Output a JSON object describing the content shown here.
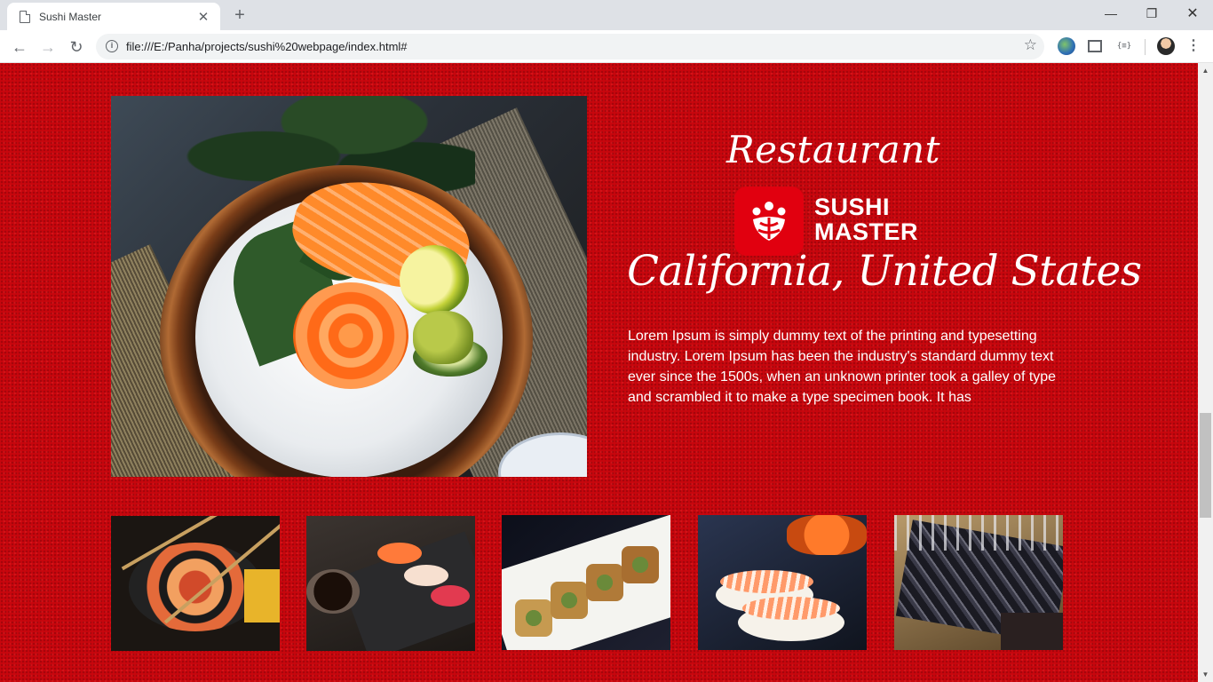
{
  "browser": {
    "tab_title": "Sushi Master",
    "tab_close": "✕",
    "new_tab": "+",
    "url": "file:///E:/Panha/projects/sushi%20webpage/index.html#",
    "controls": {
      "minimize": "—",
      "restore": "❐",
      "close": "✕"
    },
    "nav": {
      "back": "←",
      "forward": "→",
      "reload": "↻"
    },
    "star": "☆",
    "code_ext": "{≡}",
    "menu": "⋮"
  },
  "page": {
    "restaurant_heading": "Restaurant",
    "logo": {
      "line1": "SUSHI",
      "line2": "MASTER"
    },
    "location_heading": "California, United States",
    "description": "Lorem Ipsum is simply dummy text of the printing and typesetting industry. Lorem Ipsum has been the industry's standard dummy text ever since the 1500s, when an unknown printer took a galley of type and scrambled it to make a type specimen book. It has",
    "accent_color": "#c8060d",
    "thumbnails": [
      "sushi-platter-chopsticks",
      "nigiri-on-slate",
      "eel-rolls-on-plate",
      "shrimp-nigiri",
      "catering-buffet"
    ]
  }
}
